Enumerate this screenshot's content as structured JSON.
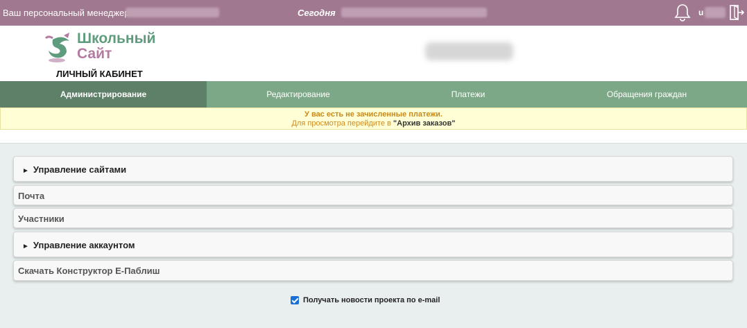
{
  "topbar": {
    "manager_label": "Ваш персональный менеджер:",
    "today_label": "Сегодня",
    "user_initial": "u"
  },
  "header": {
    "logo_line1": "Школьный",
    "logo_line2": "Сайт",
    "cabinet_label": "ЛИЧНЫЙ КАБИНЕТ"
  },
  "nav": {
    "tabs": [
      {
        "label": "Администрирование",
        "active": true
      },
      {
        "label": "Редактирование",
        "active": false
      },
      {
        "label": "Платежи",
        "active": false
      },
      {
        "label": "Обращения граждан",
        "active": false
      }
    ]
  },
  "notice": {
    "line1": "У вас есть не зачисленные платежи.",
    "line2_prefix": "Для просмотра перейдите в ",
    "line2_link": "\"Архив заказов\""
  },
  "menu": {
    "items": [
      {
        "label": "Управление сайтами",
        "expandable": true
      },
      {
        "label": "Почта",
        "expandable": false
      },
      {
        "label": "Участники",
        "expandable": false
      },
      {
        "label": "Управление аккаунтом",
        "expandable": true
      },
      {
        "label": "Скачать Конструктор Е-Паблиш",
        "expandable": false
      }
    ],
    "arrow_glyph": "►"
  },
  "newsletter": {
    "label": "Получать новости проекта по e-mail",
    "checked": true
  },
  "colors": {
    "topbar": "#a07890",
    "nav": "#7da888",
    "nav_active": "#5e7f68",
    "notice_bg": "#fffed5",
    "panel_bg": "#e9eeee"
  }
}
